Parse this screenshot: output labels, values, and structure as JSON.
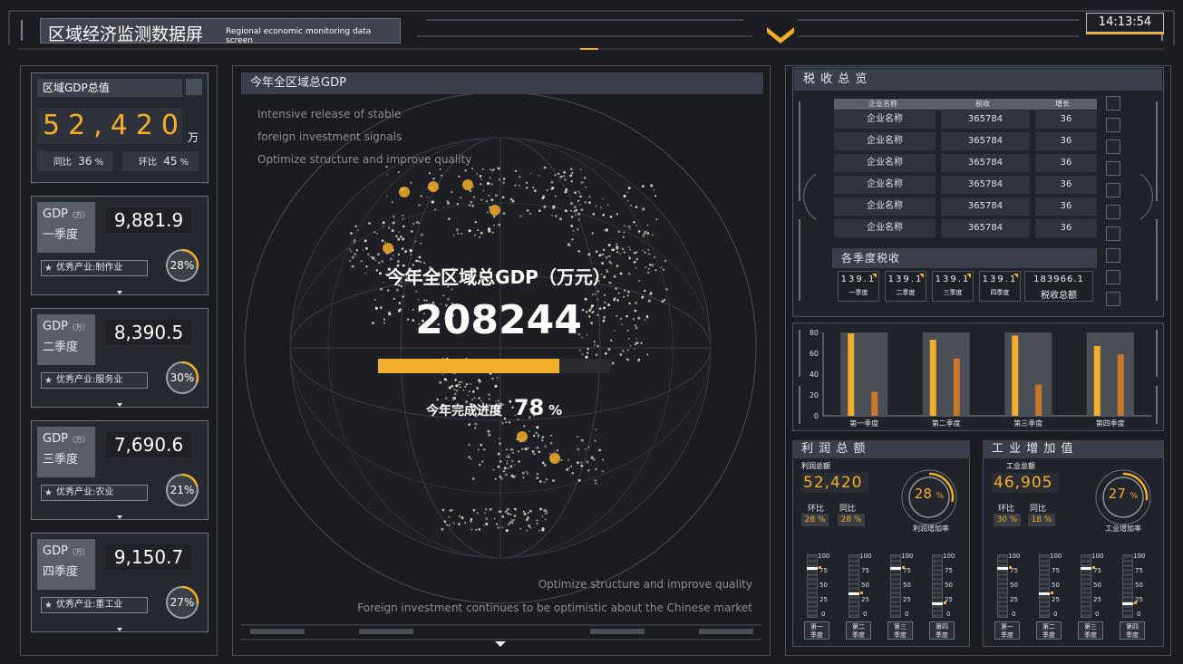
{
  "header": {
    "title": "区域经济监测数据屏",
    "subtitle": "Regional economic monitoring data screen",
    "clock": "14:13:54"
  },
  "gdp_total": {
    "title": "区域GDP总值",
    "value": "52,420",
    "unit": "万",
    "yoy_label": "同比",
    "yoy_value": "36",
    "yoy_unit": "%",
    "mom_label": "环比",
    "mom_value": "45",
    "mom_unit": "%"
  },
  "quarters": [
    {
      "gdp_label": "GDP",
      "unit": "（万）",
      "name": "一季度",
      "value": "9,881.9",
      "industry": "优秀产业:制作业",
      "percent": "28%",
      "fraction": 0.28
    },
    {
      "gdp_label": "GDP",
      "unit": "（万）",
      "name": "二季度",
      "value": "8,390.5",
      "industry": "优秀产业:服务业",
      "percent": "30%",
      "fraction": 0.3
    },
    {
      "gdp_label": "GDP",
      "unit": "（万）",
      "name": "三季度",
      "value": "7,690.6",
      "industry": "优秀产业:农业",
      "percent": "21%",
      "fraction": 0.21
    },
    {
      "gdp_label": "GDP",
      "unit": "（万）",
      "name": "四季度",
      "value": "9,150.7",
      "industry": "优秀产业:重工业",
      "percent": "27%",
      "fraction": 0.27
    }
  ],
  "center": {
    "title": "今年全区域总GDP",
    "lines_top": [
      "Intensive release of stable",
      "foreign investment signals",
      "Optimize structure and improve quality"
    ],
    "lines_bottom": [
      "Optimize structure and improve quality",
      "Foreign investment continues to be optimistic about the Chinese market"
    ],
    "headline": "今年全区域总GDP（万元）",
    "value": "208244",
    "progress_label": "今年完成进度",
    "progress_value": "78",
    "progress_unit": "%",
    "progress_fraction": 0.78
  },
  "tax": {
    "title": "税 收 总 览",
    "columns": [
      "企业名称",
      "税收",
      "增长"
    ],
    "rows": [
      [
        "企业名称",
        "365784",
        "36"
      ],
      [
        "企业名称",
        "365784",
        "36"
      ],
      [
        "企业名称",
        "365784",
        "36"
      ],
      [
        "企业名称",
        "365784",
        "36"
      ],
      [
        "企业名称",
        "365784",
        "36"
      ],
      [
        "企业名称",
        "365784",
        "36"
      ]
    ],
    "quarterly_title": "各季度税收",
    "quarterly": [
      {
        "value": "139.1",
        "label": "一季度"
      },
      {
        "value": "139.1",
        "label": "二季度"
      },
      {
        "value": "139.1",
        "label": "三季度"
      },
      {
        "value": "139.1",
        "label": "四季度"
      }
    ],
    "total": {
      "value": "183966.1",
      "label": "税收总额"
    }
  },
  "chart_data": {
    "type": "bar",
    "categories": [
      "第一季度",
      "第二季度",
      "第三季度",
      "第四季度"
    ],
    "series": [
      {
        "values": [
          79,
          73,
          77,
          67
        ],
        "color": "#f3ae2c"
      },
      {
        "values": [
          23,
          55,
          30,
          59
        ],
        "color": "#c8782b"
      }
    ],
    "background_values": [
      80,
      80,
      80,
      80
    ],
    "ylim": [
      0,
      80
    ],
    "yticks": [
      0,
      20,
      40,
      60,
      80
    ]
  },
  "profit": {
    "title": "利 润 总 额",
    "sub_title": "利润总额",
    "value": "52,420",
    "mom_label": "环比",
    "yoy_label": "同比",
    "mom_value": "28 %",
    "yoy_value": "28 %",
    "rate_value": "28",
    "rate_unit": "%",
    "rate_fraction": 0.28,
    "rate_label": "利润增加率",
    "gauges": [
      {
        "line1": "第一",
        "line2": "季度",
        "level": 0.8
      },
      {
        "line1": "第二",
        "line2": "季度",
        "level": 0.4
      },
      {
        "line1": "第三",
        "line2": "季度",
        "level": 0.8
      },
      {
        "line1": "第四",
        "line2": "季度",
        "level": 0.25
      }
    ]
  },
  "industry": {
    "title": "工 业 增 加 值",
    "sub_title": "工业总额",
    "value": "46,905",
    "mom_label": "环比",
    "yoy_label": "同比",
    "mom_value": "30 %",
    "yoy_value": "18 %",
    "rate_value": "27",
    "rate_unit": "%",
    "rate_fraction": 0.27,
    "rate_label": "工业增加率",
    "gauges": [
      {
        "line1": "第一",
        "line2": "季度",
        "level": 0.8
      },
      {
        "line1": "第二",
        "line2": "季度",
        "level": 0.4
      },
      {
        "line1": "第三",
        "line2": "季度",
        "level": 0.8
      },
      {
        "line1": "第四",
        "line2": "季度",
        "level": 0.25
      }
    ]
  },
  "gauge_ticks": [
    "100",
    "75",
    "50",
    "25",
    "0"
  ],
  "colors": {
    "accent": "#f3ae2c",
    "accent2": "#c8782b",
    "panel": "#3a3f49",
    "bg": "#1b1d22"
  }
}
